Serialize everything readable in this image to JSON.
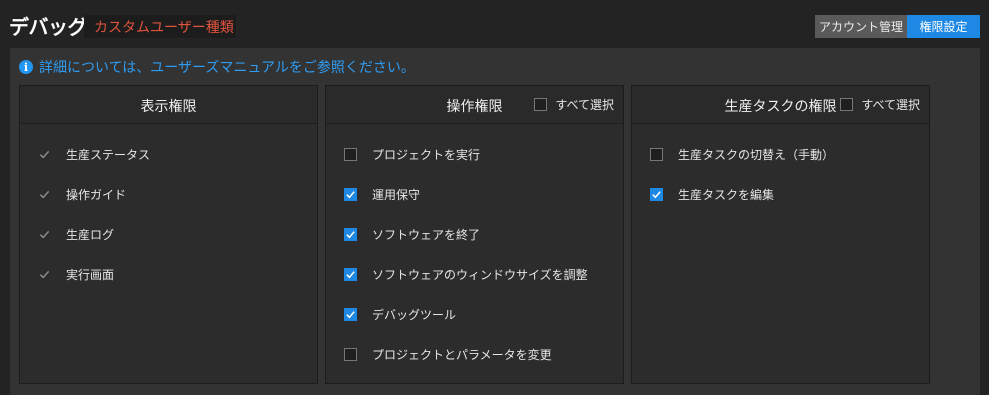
{
  "header": {
    "title": "デバッグ",
    "user_type": "カスタムユーザー種類",
    "tabs": [
      {
        "label": "アカウント管理",
        "active": false
      },
      {
        "label": "権限設定",
        "active": true
      }
    ]
  },
  "info": {
    "icon": "info-icon",
    "text": "詳細については、ユーザーズマニュアルをご参照ください。"
  },
  "cards": [
    {
      "title": "表示権限",
      "select_all": null,
      "items": [
        {
          "label": "生産ステータス",
          "checked": true,
          "disabled": true
        },
        {
          "label": "操作ガイド",
          "checked": true,
          "disabled": true
        },
        {
          "label": "生産ログ",
          "checked": true,
          "disabled": true
        },
        {
          "label": "実行画面",
          "checked": true,
          "disabled": true
        }
      ]
    },
    {
      "title": "操作権限",
      "select_all": "すべて選択",
      "items": [
        {
          "label": "プロジェクトを実行",
          "checked": false
        },
        {
          "label": "運用保守",
          "checked": true
        },
        {
          "label": "ソフトウェアを終了",
          "checked": true
        },
        {
          "label": "ソフトウェアのウィンドウサイズを調整",
          "checked": true
        },
        {
          "label": "デバッグツール",
          "checked": true
        },
        {
          "label": "プロジェクトとパラメータを変更",
          "checked": false
        }
      ]
    },
    {
      "title": "生産タスクの権限",
      "select_all": "すべて選択",
      "items": [
        {
          "label": "生産タスクの切替え（手動）",
          "checked": false
        },
        {
          "label": "生産タスクを編集",
          "checked": true
        }
      ]
    }
  ],
  "colors": {
    "accent": "#1e88e5",
    "user_type_text": "#e0533d",
    "info_text": "#2f9cf2"
  }
}
